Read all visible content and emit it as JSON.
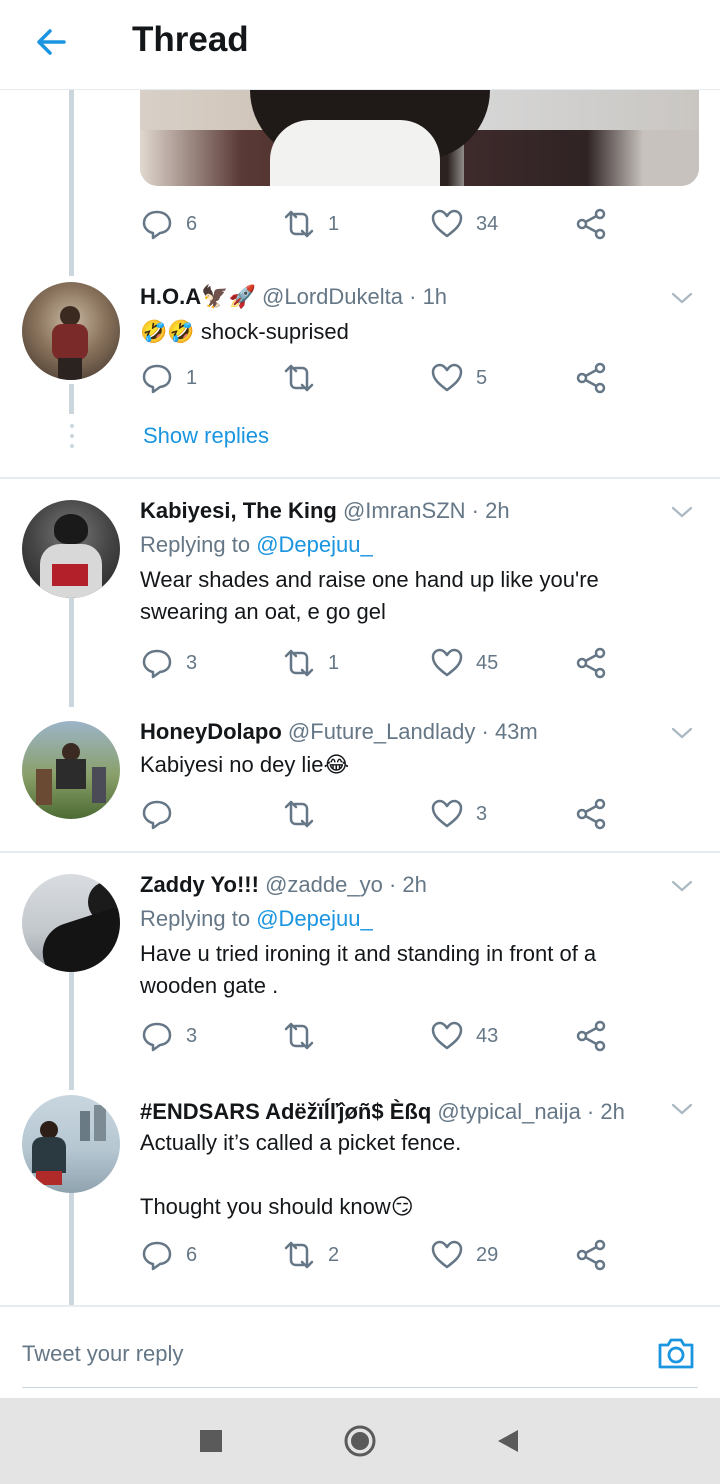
{
  "header": {
    "title": "Thread"
  },
  "first_tweet_actions": {
    "replies": "6",
    "retweets": "1",
    "likes": "34"
  },
  "tweets": [
    {
      "name": "H.O.A🦅🚀",
      "handle": "@LordDukelta",
      "time": "1h",
      "replying_to": "",
      "text": "🤣🤣 shock-suprised",
      "replies": "1",
      "retweets": "",
      "likes": "5"
    },
    {
      "name": "Kabiyesi, The King",
      "handle": "@ImranSZN",
      "time": "2h",
      "replying_to_prefix": "Replying to ",
      "replying_to": "@Depejuu_",
      "text": "Wear shades and raise one hand up like you're swearing an oat, e go gel",
      "replies": "3",
      "retweets": "1",
      "likes": "45"
    },
    {
      "name": "HoneyDolapo",
      "handle": "@Future_Landlady",
      "time": "43m",
      "replying_to": "",
      "text": "Kabiyesi no dey lie😂",
      "replies": "",
      "retweets": "",
      "likes": "3"
    },
    {
      "name": "Zaddy Yo!!!",
      "handle": "@zadde_yo",
      "time": "2h",
      "replying_to_prefix": "Replying to ",
      "replying_to": "@Depejuu_",
      "text": "Have u tried ironing it and standing in front of a wooden gate .",
      "replies": "3",
      "retweets": "",
      "likes": "43"
    },
    {
      "name": "#ENDSARS Adëžïĺľĵøñ$ Èßq",
      "handle": "@typical_naija",
      "time": "2h",
      "replying_to": "",
      "text_line1": "Actually it’s called a picket fence.",
      "text_line2": "Thought you should know😏",
      "replies": "6",
      "retweets": "2",
      "likes": "29"
    }
  ],
  "show_replies": "Show replies",
  "composer": {
    "placeholder": "Tweet your reply"
  },
  "time_separator": " · ",
  "colors": {
    "accent": "#1b95e0",
    "text": "#14171a",
    "secondary": "#657786",
    "line": "#ccd6dd"
  },
  "icons": [
    "back-arrow-icon",
    "chevron-down-icon",
    "reply-icon",
    "retweet-icon",
    "like-icon",
    "share-icon",
    "camera-icon"
  ]
}
